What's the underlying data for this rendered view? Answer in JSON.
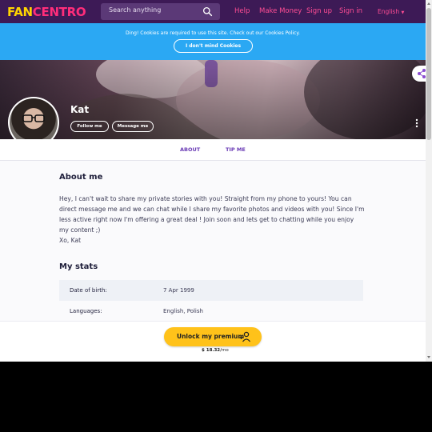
{
  "nav": {
    "logo_part1": "FAN",
    "logo_part2": "CENTRO",
    "search_placeholder": "Search anything",
    "links": [
      "Help",
      "Make Money",
      "Sign up",
      "Sign in"
    ],
    "language": "English"
  },
  "cookie": {
    "text": "Ding! Cookies are required to use this site. Check out our Cookies Policy.",
    "button": "I don't mind Cookies"
  },
  "profile": {
    "name": "Kat",
    "follow_label": "Follow me",
    "message_label": "Message me"
  },
  "tabs": [
    "ABOUT",
    "TIP ME"
  ],
  "about": {
    "heading": "About me",
    "lines": [
      "Hey, I can't wait to share my private stories with you! Straight from my phone to yours! You can",
      "direct message me and we can chat while I share my favorite photos and videos with you! Since I'm",
      "less active right now I'm offering a great deal ! Join soon and lets get to chatting while you enjoy",
      "my content ;)",
      "Xo, Kat"
    ]
  },
  "stats": {
    "heading": "My stats",
    "rows": [
      {
        "label": "Date of birth:",
        "value": "7 Apr 1999"
      },
      {
        "label": "Languages:",
        "value": "English, Polish"
      }
    ]
  },
  "unlock": {
    "label": "Unlock my premium",
    "price": "$ 18.32",
    "per": "/mo"
  },
  "colors": {
    "nav_bg": "#3d1a56",
    "accent_pink": "#ff4d94",
    "cookie_bg": "#2ba8f3",
    "tab_purple": "#6a3bb5",
    "button_yellow": "#ffc21a"
  }
}
